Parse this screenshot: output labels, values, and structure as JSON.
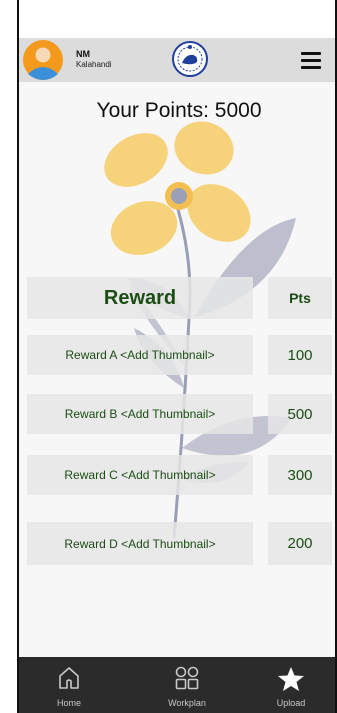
{
  "header": {
    "user_name": "NM",
    "user_location": "Kalahandi",
    "avatar_icon": "user-avatar-icon",
    "emblem_icon": "odisha-emblem-icon",
    "menu_icon": "hamburger-menu-icon"
  },
  "points": {
    "label": "Your Points: 5000"
  },
  "table": {
    "headers": {
      "reward": "Reward",
      "pts": "Pts"
    },
    "rows": [
      {
        "name": "Reward A <Add Thumbnail>",
        "pts": "100"
      },
      {
        "name": "Reward B <Add Thumbnail>",
        "pts": "500"
      },
      {
        "name": "Reward C <Add Thumbnail>",
        "pts": "300"
      },
      {
        "name": "Reward D <Add Thumbnail>",
        "pts": "200"
      }
    ]
  },
  "nav": {
    "items": [
      {
        "label": "Home",
        "icon": "home-icon"
      },
      {
        "label": "Workplan",
        "icon": "grid-icon"
      },
      {
        "label": "Upload",
        "icon": "star-icon"
      }
    ]
  },
  "colors": {
    "accent_green": "#1b4d14",
    "header_bg": "#dcdcdc",
    "nav_bg": "#2b2b2b",
    "petal": "#f6d27a",
    "leaf": "#8e92ad"
  }
}
